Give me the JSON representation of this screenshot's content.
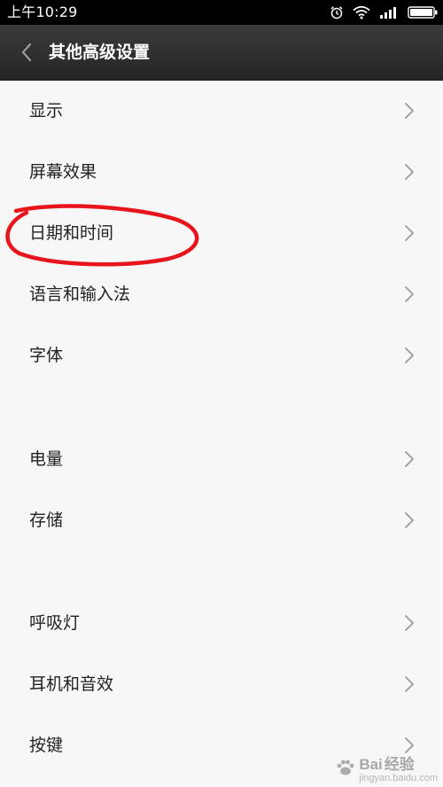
{
  "status_bar": {
    "time": "上午10:29",
    "icons": [
      "alarm-icon",
      "wifi-icon",
      "signal-icon",
      "battery-icon"
    ]
  },
  "header": {
    "title": "其他高级设置",
    "back_icon": "chevron-left-icon"
  },
  "settings": {
    "items": [
      {
        "label": "显示"
      },
      {
        "label": "屏幕效果"
      },
      {
        "label": "日期和时间",
        "highlighted": true
      },
      {
        "label": "语言和输入法"
      },
      {
        "label": "字体"
      },
      {
        "label": "电量"
      },
      {
        "label": "存储"
      },
      {
        "label": "呼吸灯"
      },
      {
        "label": "耳机和音效"
      },
      {
        "label": "按键"
      }
    ]
  },
  "annotation": {
    "color": "#e8141c"
  },
  "watermark": {
    "brand": "Bai",
    "brand_suffix": "经验",
    "sub": "jingyan.baidu.com"
  },
  "colors": {
    "background": "#f7f7f7",
    "titlebar": "#2e2e2e",
    "text": "#222222",
    "chevron": "#9a9a9a"
  }
}
